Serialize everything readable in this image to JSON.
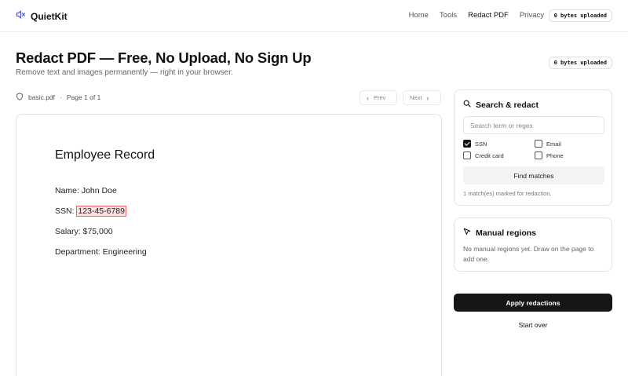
{
  "brand": {
    "name": "QuietKit",
    "icon": "muted-speaker-icon",
    "accent": "#4f5bd5"
  },
  "nav": {
    "items": [
      "Home",
      "Tools",
      "Redact PDF",
      "Privacy"
    ],
    "active": "Redact PDF"
  },
  "upload_badge": "0 bytes uploaded",
  "page": {
    "title": "Redact PDF — Free, No Upload, No Sign Up",
    "subtitle": "Remove text and images permanently — right in your browser.",
    "badge": "0 bytes uploaded"
  },
  "file": {
    "name": "basic.pdf",
    "separator": "·",
    "page_info": "Page 1 of 1",
    "icon": "shield-icon"
  },
  "pager": {
    "prev": "Prev",
    "next": "Next"
  },
  "document": {
    "title": "Employee Record",
    "lines": [
      {
        "label": "Name: ",
        "value": "John Doe"
      },
      {
        "label": "SSN: ",
        "value": "123-45-6789",
        "redacted": true
      },
      {
        "label": "Salary: ",
        "value": "$75,000"
      },
      {
        "label": "Department: ",
        "value": "Engineering"
      }
    ],
    "redaction_color": "#e66666"
  },
  "search_panel": {
    "title": "Search & redact",
    "icon": "search-icon",
    "placeholder": "Search term or regex",
    "value": "",
    "options": [
      {
        "label": "SSN",
        "checked": true
      },
      {
        "label": "Email",
        "checked": false
      },
      {
        "label": "Credit card",
        "checked": false
      },
      {
        "label": "Phone",
        "checked": false
      }
    ],
    "find_label": "Find matches",
    "status": "1 match(es) marked for redaction."
  },
  "manual_panel": {
    "title": "Manual regions",
    "icon": "cursor-arrow-icon",
    "text": "No manual regions yet. Draw on the page to add one."
  },
  "actions": {
    "apply": "Apply redactions",
    "start_over": "Start over"
  }
}
